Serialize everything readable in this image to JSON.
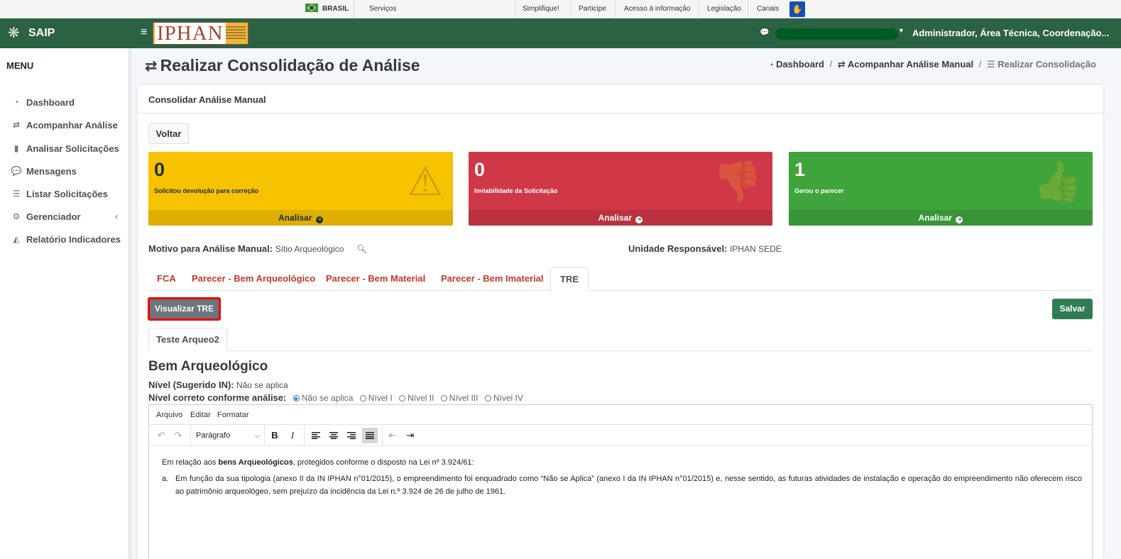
{
  "govbar": {
    "country": "BRASIL",
    "servicos": "Serviços",
    "links": [
      "Simplifique!",
      "Participe",
      "Acesso à informação",
      "Legislação",
      "Canais"
    ]
  },
  "header": {
    "app_name": "SAIP",
    "logo_text": "IPHAN",
    "user_roles": "Administrador, Área Técnica, Coordenação..."
  },
  "sidebar": {
    "title": "MENU",
    "items": [
      {
        "label": "Dashboard",
        "icon": "tachometer-icon"
      },
      {
        "label": "Acompanhar Análise",
        "icon": "exchange-icon"
      },
      {
        "label": "Analisar Solicitações",
        "icon": "book-icon"
      },
      {
        "label": "Mensagens",
        "icon": "comments-icon"
      },
      {
        "label": "Listar Solicitações",
        "icon": "list-icon"
      },
      {
        "label": "Gerenciador",
        "icon": "cogs-icon"
      },
      {
        "label": "Relatório Indicadores",
        "icon": "area-chart-icon"
      }
    ]
  },
  "page": {
    "title": "Realizar Consolidação de Análise",
    "breadcrumb": [
      "Dashboard",
      "Acompanhar Análise Manual",
      "Realizar Consolidação"
    ]
  },
  "card": {
    "title": "Consolidar Análise Manual",
    "back_button": "Voltar",
    "boxes": [
      {
        "count": "0",
        "label": "Solicitou devolução para correção",
        "action": "Analisar",
        "color": "#f7c200"
      },
      {
        "count": "0",
        "label": "Inviabilidade da Solicitação",
        "action": "Analisar",
        "color": "#d03747"
      },
      {
        "count": "1",
        "label": "Gerou o parecer",
        "action": "Analisar",
        "color": "#3fa43c"
      }
    ],
    "motivo_label": "Motivo para Análise Manual:",
    "motivo_value": "Sítio Arqueológico",
    "unidade_label": "Unidade Responsável:",
    "unidade_value": "IPHAN SEDE",
    "tabs": [
      "FCA",
      "Parecer - Bem Arqueológico",
      "Parecer - Bem Material",
      "Parecer - Bem Imaterial",
      "TRE"
    ],
    "active_tab": "TRE",
    "visualizar_button": "Visualizar TRE",
    "salvar_button": "Salvar",
    "subtab": "Teste Arqueo2",
    "section_title": "Bem Arqueológico",
    "nivel_label": "Nível (Sugerido IN):",
    "nivel_value": "Não se aplica",
    "nivel_correto_label": "Nível correto conforme análise:",
    "nivel_options": [
      "Não se aplica",
      "Nível I",
      "Nível II",
      "Nível III",
      "Nível IV"
    ],
    "nivel_selected": "Não se aplica"
  },
  "editor": {
    "menu": [
      "Arquivo",
      "Editar",
      "Formatar"
    ],
    "block_format": "Parágrafo",
    "paragraph_prefix": "Em relação aos ",
    "paragraph_bold": "bens Arqueológicos",
    "paragraph_suffix": ", protegidos conforme o disposto na Lei nº 3.924/61:",
    "list_marker": "a.",
    "list_text": "Em função da sua tipologia (anexo II da IN IPHAN n°01/2015), o empreendimento foi enquadrado como “Não se Aplica” (anexo I da IN IPHAN n°01/2015) e, nesse sentido, as futuras atividades de instalação e operação do empreendimento não oferecem risco ao patrimônio arqueológeo, sem prejuízo da incidência da Lei n.º 3.924 de 26 de julho de 1961."
  }
}
